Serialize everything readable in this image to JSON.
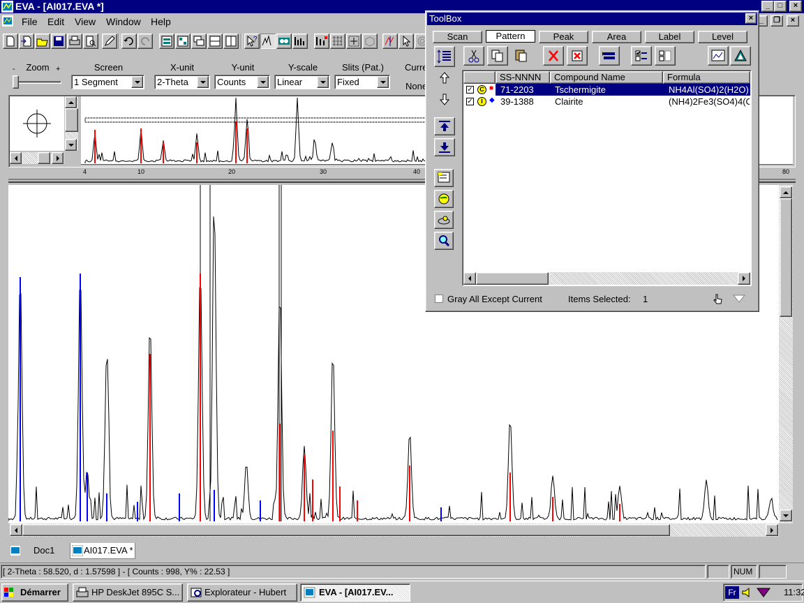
{
  "window": {
    "title": "EVA - [AI017.EVA *]"
  },
  "menu": [
    "File",
    "Edit",
    "View",
    "Window",
    "Help"
  ],
  "controls": {
    "zoom": {
      "label": "Zoom",
      "minus": "-",
      "plus": "+"
    },
    "screen": {
      "label": "Screen",
      "value": "1 Segment"
    },
    "xunit": {
      "label": "X-unit",
      "value": "2-Theta"
    },
    "yunit": {
      "label": "Y-unit",
      "value": "Counts"
    },
    "yscale": {
      "label": "Y-scale",
      "value": "Linear"
    },
    "slits": {
      "label": "Slits (Pat.)",
      "value": "Fixed"
    },
    "current": {
      "label": "Curre",
      "value": "None"
    }
  },
  "overview": {
    "ticks": [
      "4",
      "10",
      "20",
      "30",
      "40",
      "80"
    ]
  },
  "toolbox": {
    "title": "ToolBox",
    "tabs": [
      "Scan",
      "Pattern",
      "Peak",
      "Area",
      "Label",
      "Level"
    ],
    "active_tab": "Pattern",
    "columns": [
      "SS-NNNN",
      "Compound Name",
      "Formula"
    ],
    "rows": [
      {
        "badge": "C",
        "marker": "■",
        "marker_color": "#ff0000",
        "id": "71-2203",
        "name": "Tschermigite",
        "formula": "NH4Al(SO4)2(H2O)1",
        "selected": true
      },
      {
        "badge": "I",
        "marker": "◆",
        "marker_color": "#0000ff",
        "id": "39-1388",
        "name": "Clairite",
        "formula": "(NH4)2Fe3(SO4)4(O",
        "selected": false
      }
    ],
    "gray_all_label": "Gray All Except Current",
    "items_selected_label": "Items Selected:",
    "items_selected_value": "1"
  },
  "doc_tabs": [
    "Doc1",
    "AI017.EVA *"
  ],
  "status": {
    "text": "[ 2-Theta : 58.520, d : 1.57598 ] - [ Counts : 998, Y% : 22.53 ]",
    "num": "NUM"
  },
  "taskbar": {
    "start": "Démarrer",
    "tasks": [
      "HP DeskJet 895C S...",
      "Explorateur - Hubert",
      "EVA - [AI017.EV..."
    ],
    "lang": "Fr",
    "clock": "11:32"
  },
  "colors": {
    "title_bg": "#000080",
    "face": "#c0c0c0",
    "pattern1": "#ff0000",
    "pattern2": "#0000ff"
  }
}
